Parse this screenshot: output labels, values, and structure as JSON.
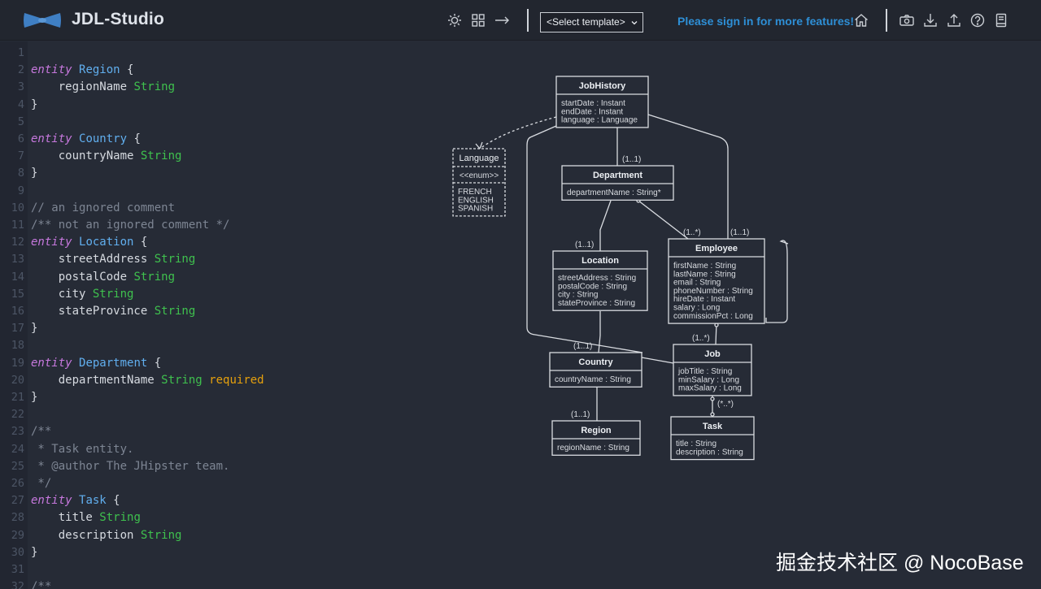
{
  "header": {
    "app_title": "JDL-Studio",
    "template_select": "<Select template>",
    "signin_text": "Please sign in for more features!",
    "icons": [
      "sun-icon",
      "grid-icon",
      "arrow-right-icon",
      "home-icon",
      "camera-icon",
      "download-icon",
      "upload-icon",
      "help-icon",
      "book-icon"
    ]
  },
  "editor": {
    "line_numbers": [
      "1",
      "2",
      "3",
      "4",
      "5",
      "6",
      "7",
      "8",
      "9",
      "10",
      "11",
      "12",
      "13",
      "14",
      "15",
      "16",
      "17",
      "18",
      "19",
      "20",
      "21",
      "22",
      "23",
      "24",
      "25",
      "26",
      "27",
      "28",
      "29",
      "30",
      "31",
      "32"
    ],
    "lines": [
      [],
      [
        {
          "c": "kw",
          "t": "entity"
        },
        {
          "c": "",
          "t": " "
        },
        {
          "c": "ent",
          "t": "Region"
        },
        {
          "c": "",
          "t": " {"
        }
      ],
      [
        {
          "c": "",
          "t": "    regionName "
        },
        {
          "c": "typ",
          "t": "String"
        }
      ],
      [
        {
          "c": "",
          "t": "}"
        }
      ],
      [],
      [
        {
          "c": "kw",
          "t": "entity"
        },
        {
          "c": "",
          "t": " "
        },
        {
          "c": "ent",
          "t": "Country"
        },
        {
          "c": "",
          "t": " {"
        }
      ],
      [
        {
          "c": "",
          "t": "    countryName "
        },
        {
          "c": "typ",
          "t": "String"
        }
      ],
      [
        {
          "c": "",
          "t": "}"
        }
      ],
      [],
      [
        {
          "c": "cmt",
          "t": "// an ignored comment"
        }
      ],
      [
        {
          "c": "cmt",
          "t": "/** not an ignored comment */"
        }
      ],
      [
        {
          "c": "kw",
          "t": "entity"
        },
        {
          "c": "",
          "t": " "
        },
        {
          "c": "ent",
          "t": "Location"
        },
        {
          "c": "",
          "t": " {"
        }
      ],
      [
        {
          "c": "",
          "t": "    streetAddress "
        },
        {
          "c": "typ",
          "t": "String"
        }
      ],
      [
        {
          "c": "",
          "t": "    postalCode "
        },
        {
          "c": "typ",
          "t": "String"
        }
      ],
      [
        {
          "c": "",
          "t": "    city "
        },
        {
          "c": "typ",
          "t": "String"
        }
      ],
      [
        {
          "c": "",
          "t": "    stateProvince "
        },
        {
          "c": "typ",
          "t": "String"
        }
      ],
      [
        {
          "c": "",
          "t": "}"
        }
      ],
      [],
      [
        {
          "c": "kw",
          "t": "entity"
        },
        {
          "c": "",
          "t": " "
        },
        {
          "c": "ent",
          "t": "Department"
        },
        {
          "c": "",
          "t": " {"
        }
      ],
      [
        {
          "c": "",
          "t": "    departmentName "
        },
        {
          "c": "typ",
          "t": "String"
        },
        {
          "c": "",
          "t": " "
        },
        {
          "c": "req",
          "t": "required"
        }
      ],
      [
        {
          "c": "",
          "t": "}"
        }
      ],
      [],
      [
        {
          "c": "cmt",
          "t": "/**"
        }
      ],
      [
        {
          "c": "cmt",
          "t": " * Task entity."
        }
      ],
      [
        {
          "c": "cmt",
          "t": " * @author The JHipster team."
        }
      ],
      [
        {
          "c": "cmt",
          "t": " */"
        }
      ],
      [
        {
          "c": "kw",
          "t": "entity"
        },
        {
          "c": "",
          "t": " "
        },
        {
          "c": "ent",
          "t": "Task"
        },
        {
          "c": "",
          "t": " {"
        }
      ],
      [
        {
          "c": "",
          "t": "    title "
        },
        {
          "c": "typ",
          "t": "String"
        }
      ],
      [
        {
          "c": "",
          "t": "    description "
        },
        {
          "c": "typ",
          "t": "String"
        }
      ],
      [
        {
          "c": "",
          "t": "}"
        }
      ],
      [],
      [
        {
          "c": "cmt",
          "t": "/**"
        }
      ]
    ]
  },
  "diagram": {
    "entities": [
      {
        "id": "jobhistory",
        "name": "JobHistory",
        "fields": [
          "startDate : Instant",
          "endDate : Instant",
          "language : Language"
        ]
      },
      {
        "id": "language",
        "name": "Language",
        "stereotype": "<<enum>>",
        "fields": [
          "FRENCH",
          "ENGLISH",
          "SPANISH"
        ],
        "dashed": true
      },
      {
        "id": "department",
        "name": "Department",
        "fields": [
          "departmentName : String*"
        ]
      },
      {
        "id": "employee",
        "name": "Employee",
        "fields": [
          "firstName : String",
          "lastName : String",
          "email : String",
          "phoneNumber : String",
          "hireDate : Instant",
          "salary : Long",
          "commissionPct : Long"
        ]
      },
      {
        "id": "location",
        "name": "Location",
        "fields": [
          "streetAddress : String",
          "postalCode : String",
          "city : String",
          "stateProvince : String"
        ]
      },
      {
        "id": "country",
        "name": "Country",
        "fields": [
          "countryName : String"
        ]
      },
      {
        "id": "job",
        "name": "Job",
        "fields": [
          "jobTitle : String",
          "minSalary : Long",
          "maxSalary : Long"
        ]
      },
      {
        "id": "region",
        "name": "Region",
        "fields": [
          "regionName : String"
        ]
      },
      {
        "id": "task",
        "name": "Task",
        "fields": [
          "title : String",
          "description : String"
        ]
      }
    ],
    "labels": [
      "(1..1)",
      "(1..*)",
      "(1..1)",
      "(1..1)",
      "(1..1)",
      "(1..*)",
      "(*..*)",
      "(1..1)"
    ]
  },
  "watermark": "掘金技术社区 @ NocoBase"
}
